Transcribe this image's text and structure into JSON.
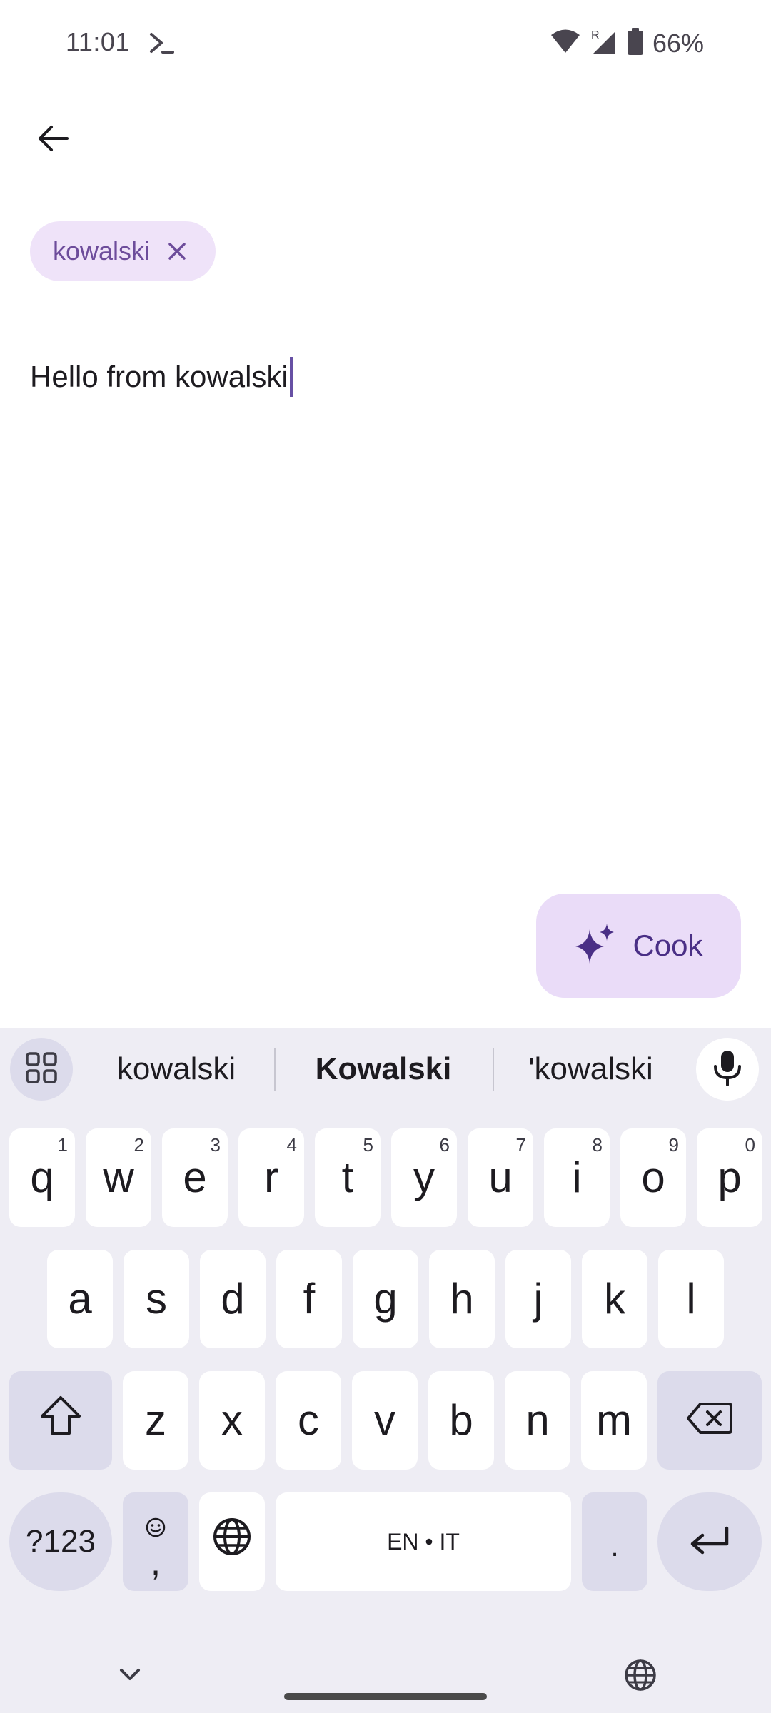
{
  "status_bar": {
    "time": "11:01",
    "battery": "66%",
    "icons": [
      "terminal-icon",
      "wifi-icon",
      "roaming-signal-icon",
      "battery-icon"
    ]
  },
  "header": {
    "back_icon": "arrow-left-icon"
  },
  "chip": {
    "label": "kowalski",
    "close_icon": "close-icon"
  },
  "editor": {
    "text": "Hello from kowalski"
  },
  "fab": {
    "label": "Cook",
    "icon": "sparkle-icon"
  },
  "keyboard": {
    "suggestions": [
      "kowalski",
      "Kowalski",
      "'kowalski"
    ],
    "row1": [
      {
        "letter": "q",
        "hint": "1"
      },
      {
        "letter": "w",
        "hint": "2"
      },
      {
        "letter": "e",
        "hint": "3"
      },
      {
        "letter": "r",
        "hint": "4"
      },
      {
        "letter": "t",
        "hint": "5"
      },
      {
        "letter": "y",
        "hint": "6"
      },
      {
        "letter": "u",
        "hint": "7"
      },
      {
        "letter": "i",
        "hint": "8"
      },
      {
        "letter": "o",
        "hint": "9"
      },
      {
        "letter": "p",
        "hint": "0"
      }
    ],
    "row2": [
      "a",
      "s",
      "d",
      "f",
      "g",
      "h",
      "j",
      "k",
      "l"
    ],
    "row3": [
      "z",
      "x",
      "c",
      "v",
      "b",
      "n",
      "m"
    ],
    "symbols_label": "?123",
    "comma_label": ",",
    "space_label": "EN • IT",
    "period_label": ".",
    "colors": {
      "background": "#eeedf4",
      "key": "#ffffff",
      "modifier_key": "#dcdbeb"
    }
  },
  "colors": {
    "chip_background": "#efe3f9",
    "chip_text": "#6d4c9b",
    "fab_background": "#eadcf8",
    "fab_text": "#4a2f86",
    "caret": "#6750a4"
  }
}
